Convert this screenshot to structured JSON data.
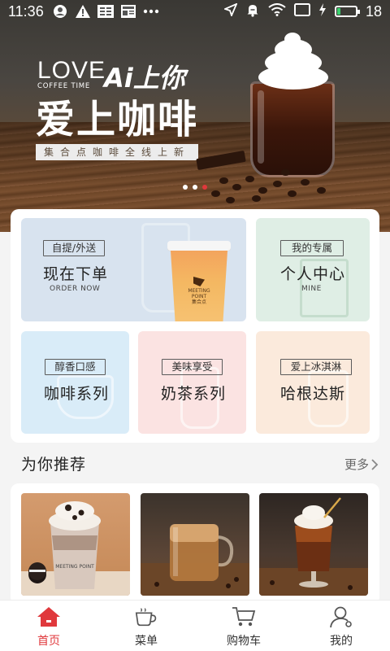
{
  "status_bar": {
    "time": "11:36",
    "battery_level": "18",
    "battery_fraction": 0.18,
    "left_icons": [
      "account-circle-icon",
      "warning-icon",
      "reader-icon",
      "news-icon",
      "more-dots-icon"
    ],
    "right_icons": [
      "location-arrow-icon",
      "alarm-muted-icon",
      "wifi-icon",
      "cast-icon",
      "charging-bolt-icon"
    ]
  },
  "banner": {
    "love": "LOVE",
    "coffee_time": "COFFEE TIME",
    "ai_line": "Ai上你",
    "main_title": "爱上咖啡",
    "subtitle": "集合点咖啡全线上新",
    "page_count": 3,
    "active_page": 3
  },
  "entries": {
    "order": {
      "tag": "自提/外送",
      "title": "现在下单",
      "sub": "ORDER NOW",
      "cup_brand": "MEETING POINT",
      "cup_brand_cn": "集合点"
    },
    "mine": {
      "tag": "我的专属",
      "title": "个人中心",
      "sub": "MINE"
    },
    "coffee": {
      "tag": "醇香口感",
      "title": "咖啡系列"
    },
    "tea": {
      "tag": "美味享受",
      "title": "奶茶系列"
    },
    "haagen": {
      "tag": "爱上冰淇淋",
      "title": "哈根达斯"
    }
  },
  "recommend": {
    "title": "为你推荐",
    "more": "更多",
    "items": [
      {
        "image": "oreo-milk-coffee-photo",
        "cup_text": "MEETING POINT"
      },
      {
        "image": "iced-latte-glass-photo"
      },
      {
        "image": "cream-cold-brew-photo"
      }
    ]
  },
  "tab_bar": {
    "active": "home",
    "accent_color": "#e0383c",
    "tabs": [
      {
        "id": "home",
        "label": "首页",
        "icon": "home-icon"
      },
      {
        "id": "menu",
        "label": "菜单",
        "icon": "coffee-cup-icon"
      },
      {
        "id": "cart",
        "label": "购物车",
        "icon": "shopping-cart-icon"
      },
      {
        "id": "mine",
        "label": "我的",
        "icon": "user-profile-icon"
      }
    ]
  }
}
